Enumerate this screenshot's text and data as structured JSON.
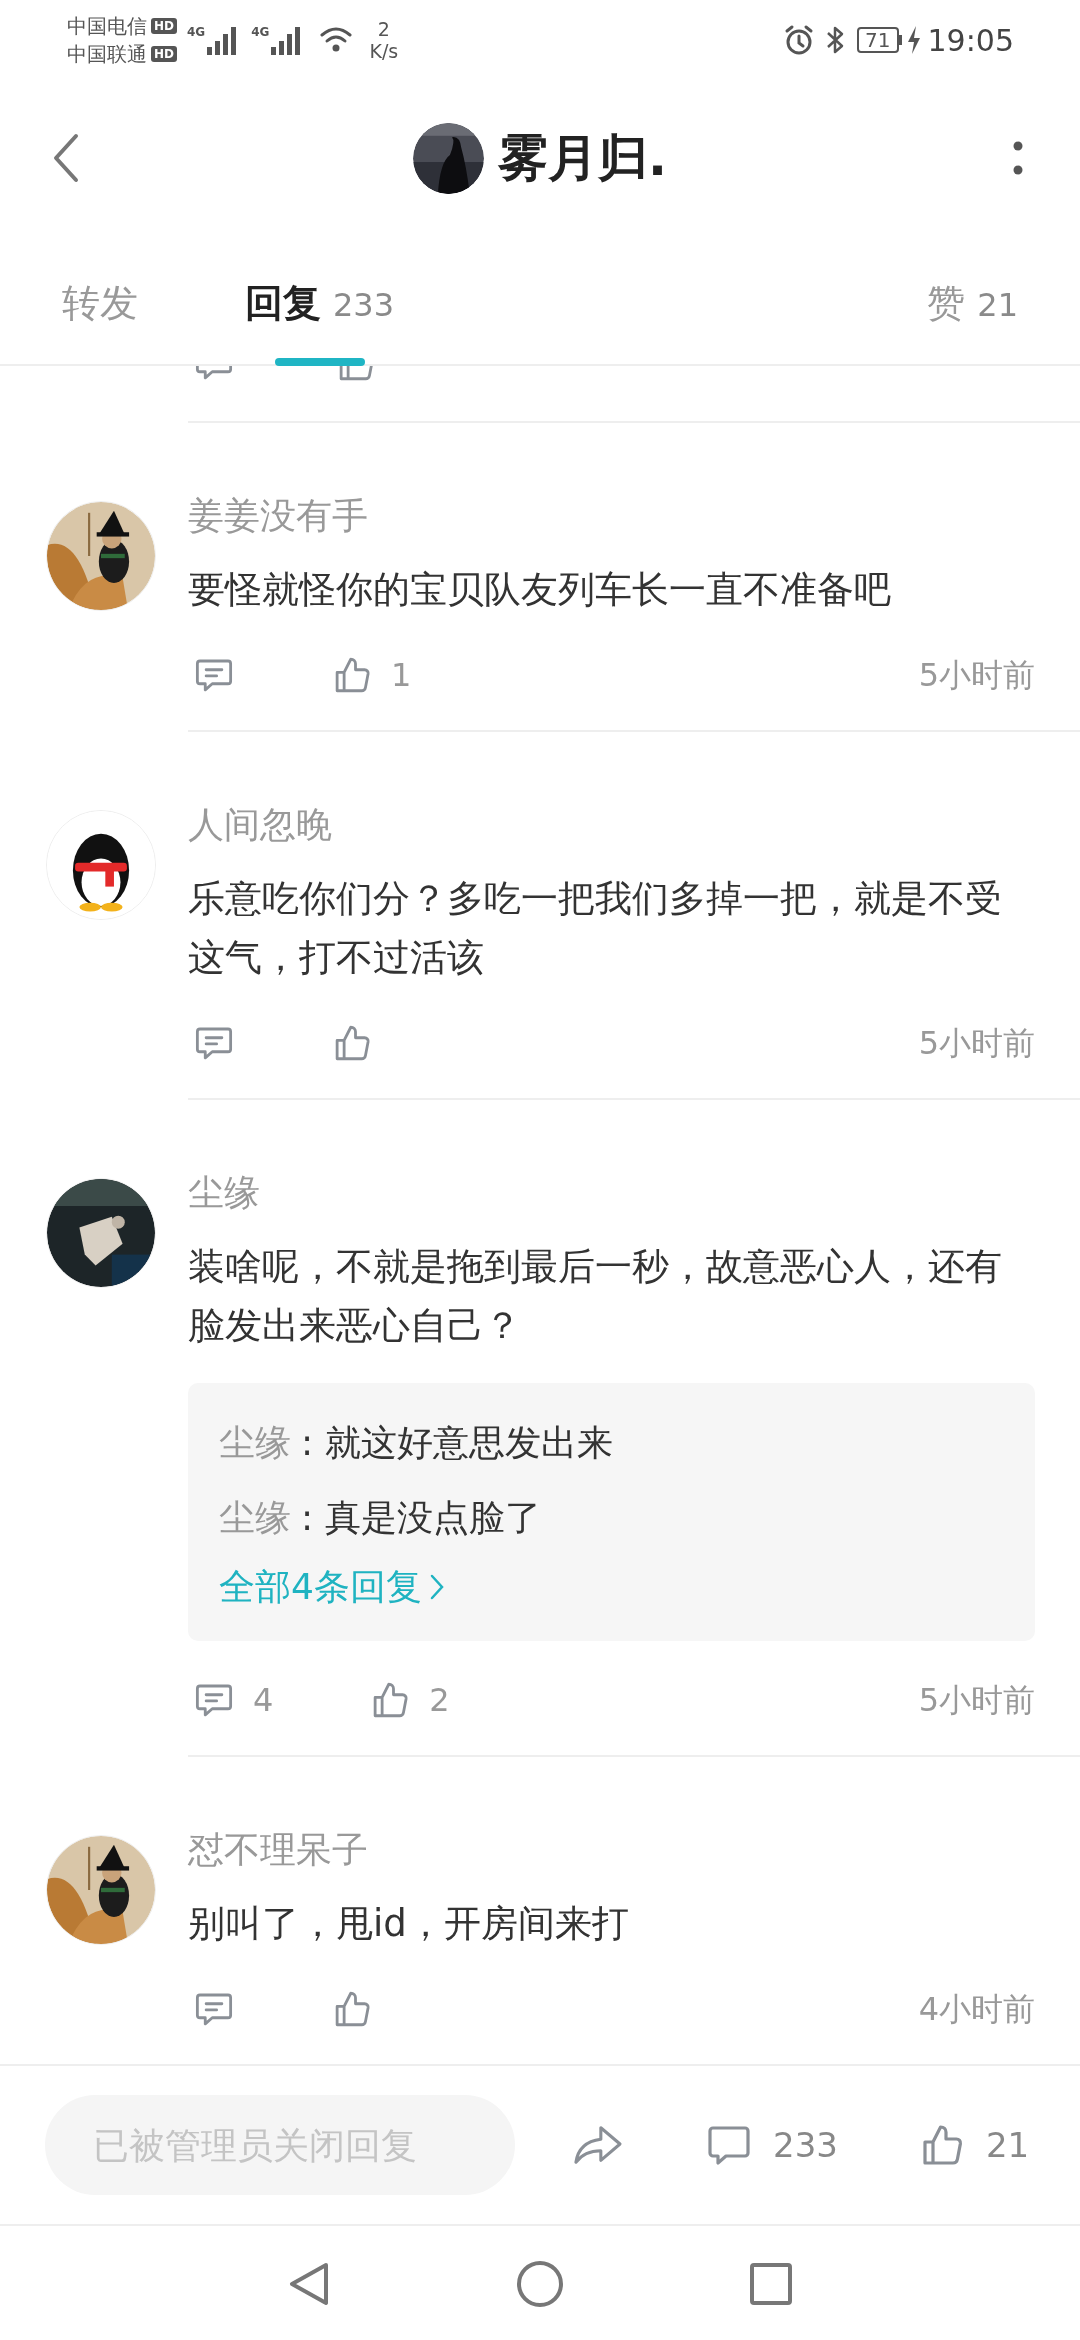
{
  "status_bar": {
    "carriers": [
      {
        "name": "中国电信",
        "badge": "HD"
      },
      {
        "name": "中国联通",
        "badge": "HD"
      }
    ],
    "networks": [
      "4G",
      "4G"
    ],
    "speed": "2",
    "speed_unit": "K/s",
    "battery": "71",
    "time": "19:05"
  },
  "header": {
    "title": "雾月归."
  },
  "tabs": [
    {
      "label": "转发",
      "selected": false
    },
    {
      "label": "回复",
      "count": "233",
      "selected": true
    },
    {
      "label": "赞",
      "count": "21",
      "selected": false
    }
  ],
  "comments": [
    {
      "user": "姜姜没有手",
      "text": "要怪就怪你的宝贝队友列车长一直不准备吧",
      "likes": "1",
      "time": "5小时前"
    },
    {
      "user": "人间忽晚",
      "text": "乐意吃你们分？多吃一把我们多掉一把，就是不受这气，打不过活该",
      "time": "5小时前"
    },
    {
      "user": "尘缘",
      "text": "装啥呢，不就是拖到最后一秒，故意恶心人，还有脸发出来恶心自己？",
      "replies": [
        {
          "user": "尘缘",
          "text": ": 就这好意思发出来"
        },
        {
          "user": "尘缘",
          "text": ": 真是没点脸了"
        }
      ],
      "more_replies": "全部4条回复",
      "reply_count": "4",
      "likes": "2",
      "time": "5小时前"
    },
    {
      "user": "怼不理呆子",
      "text": "别叫了，甩id，开房间来打",
      "time": "4小时前"
    }
  ],
  "bottom_bar": {
    "placeholder": "已被管理员关闭回复",
    "comments": "233",
    "likes": "21"
  }
}
